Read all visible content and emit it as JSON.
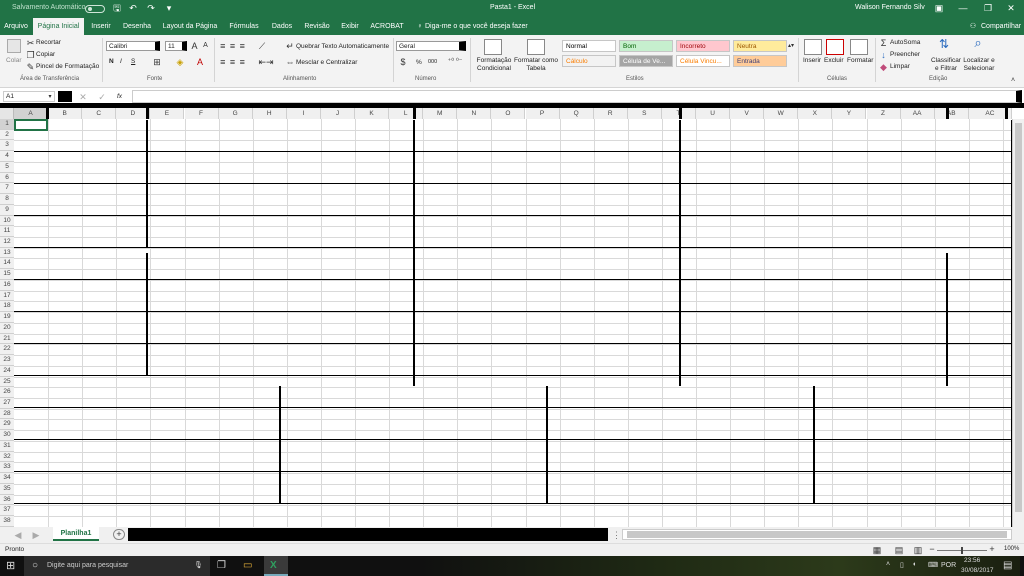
{
  "titlebar": {
    "autosave_label": "Salvamento Automático",
    "autosave_state": "off",
    "doc_title": "Pasta1  -  Excel",
    "user": "Walison Fernando Silv",
    "icons": [
      "save-icon",
      "undo-icon",
      "redo-icon",
      "customize-icon",
      "ribbon-options-icon",
      "minimize-icon",
      "restore-icon",
      "close-icon"
    ]
  },
  "tabs": [
    "Arquivo",
    "Página Inicial",
    "Inserir",
    "Desenha",
    "Layout da Página",
    "Fórmulas",
    "Dados",
    "Revisão",
    "Exibir",
    "ACROBAT"
  ],
  "active_tab": "Página Inicial",
  "tell_me": "Diga-me o que você deseja fazer",
  "share_label": "Compartilhar",
  "ribbon": {
    "clipboard": {
      "paste": "Colar",
      "cut": "Recortar",
      "copy": "Copiar",
      "format_painter": "Pincel de Formatação",
      "group": "Área de Transferência"
    },
    "font": {
      "name": "Calibri",
      "size": "11",
      "bold": "N",
      "italic": "I",
      "underline": "S",
      "group": "Fonte"
    },
    "alignment": {
      "wrap": "Quebrar Texto Automaticamente",
      "merge": "Mesclar e Centralizar",
      "group": "Alinhamento"
    },
    "number": {
      "format": "Geral",
      "percent": "%",
      "thousands": "000",
      "group": "Número"
    },
    "styles": {
      "conditional": "Formatação Condicional",
      "format_table": "Formatar como Tabela",
      "cells": [
        {
          "label": "Normal",
          "bg": "#ffffff",
          "fg": "#000000"
        },
        {
          "label": "Bom",
          "bg": "#c6efce",
          "fg": "#006100"
        },
        {
          "label": "Incorreto",
          "bg": "#ffc7ce",
          "fg": "#9c0006"
        },
        {
          "label": "Neutra",
          "bg": "#ffeb9c",
          "fg": "#9c5700"
        },
        {
          "label": "Cálculo",
          "bg": "#f2f2f2",
          "fg": "#fa7d00"
        },
        {
          "label": "Célula de Ve...",
          "bg": "#a5a5a5",
          "fg": "#ffffff"
        },
        {
          "label": "Célula Vincu...",
          "bg": "#ffffff",
          "fg": "#fa7d00"
        },
        {
          "label": "Entrada",
          "bg": "#ffcc99",
          "fg": "#3f3f76"
        }
      ],
      "group": "Estilos"
    },
    "cells_group": {
      "insert": "Inserir",
      "delete": "Excluir",
      "format": "Formatar",
      "group": "Células"
    },
    "editing": {
      "autosum": "AutoSoma",
      "fill": "Preencher",
      "clear": "Limpar",
      "sort": "Classificar e Filtrar",
      "find": "Localizar e Selecionar",
      "group": "Edição"
    }
  },
  "formula_bar": {
    "name_box": "A1",
    "fx": "fx",
    "value": ""
  },
  "columns": [
    "A",
    "B",
    "C",
    "D",
    "E",
    "F",
    "G",
    "H",
    "I",
    "J",
    "K",
    "L",
    "M",
    "N",
    "O",
    "P",
    "Q",
    "R",
    "S",
    "T",
    "U",
    "V",
    "W",
    "X",
    "Y",
    "Z",
    "AA",
    "AB",
    "AC"
  ],
  "rows": [
    "1",
    "2",
    "3",
    "4",
    "5",
    "6",
    "7",
    "8",
    "9",
    "10",
    "11",
    "12",
    "13",
    "14",
    "15",
    "16",
    "17",
    "18",
    "19",
    "20",
    "21",
    "22",
    "23",
    "24",
    "25",
    "26",
    "27",
    "28",
    "29",
    "30",
    "31",
    "32",
    "33",
    "34",
    "35",
    "36",
    "37",
    "38"
  ],
  "selected_cell": "A1",
  "sheets": [
    "Planilha1"
  ],
  "status": {
    "ready": "Pronto",
    "zoom": "100%"
  },
  "taskbar": {
    "search": "Digite aqui para pesquisar",
    "lang": "POR",
    "time": "23:56",
    "date": "30/08/2017"
  }
}
